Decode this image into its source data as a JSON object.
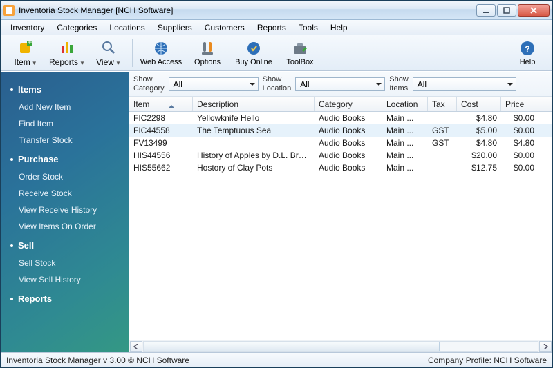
{
  "window": {
    "title": "Inventoria Stock Manager [NCH Software]"
  },
  "menu": [
    "Inventory",
    "Categories",
    "Locations",
    "Suppliers",
    "Customers",
    "Reports",
    "Tools",
    "Help"
  ],
  "toolbar": {
    "item": "Item",
    "reports": "Reports",
    "view": "View",
    "web_access": "Web Access",
    "options": "Options",
    "buy_online": "Buy Online",
    "toolbox": "ToolBox",
    "help": "Help"
  },
  "filters": {
    "show_category_label": "Show\nCategory",
    "show_category_value": "All",
    "show_location_label": "Show\nLocation",
    "show_location_value": "All",
    "show_items_label": "Show\nItems",
    "show_items_value": "All"
  },
  "sidebar": {
    "sections": [
      {
        "header": "Items",
        "items": [
          "Add New Item",
          "Find Item",
          "Transfer Stock"
        ]
      },
      {
        "header": "Purchase",
        "items": [
          "Order Stock",
          "Receive Stock",
          "View Receive History",
          "View Items On Order"
        ]
      },
      {
        "header": "Sell",
        "items": [
          "Sell Stock",
          "View Sell History"
        ]
      },
      {
        "header": "Reports",
        "items": []
      }
    ]
  },
  "grid": {
    "columns": [
      "Item",
      "Description",
      "Category",
      "Location",
      "Tax",
      "Cost",
      "Price"
    ],
    "rows": [
      {
        "item": "FIC2298",
        "desc": "Yellowknife Hello",
        "cat": "Audio Books",
        "loc": "Main ...",
        "tax": "",
        "cost": "$4.80",
        "price": "$0.00"
      },
      {
        "item": "FIC44558",
        "desc": "The Temptuous Sea",
        "cat": "Audio Books",
        "loc": "Main ...",
        "tax": "GST",
        "cost": "$5.00",
        "price": "$0.00"
      },
      {
        "item": "FV13499",
        "desc": "",
        "cat": "Audio Books",
        "loc": "Main ...",
        "tax": "GST",
        "cost": "$4.80",
        "price": "$4.80"
      },
      {
        "item": "HIS44556",
        "desc": "History of Apples by D.L. Brewer",
        "cat": "Audio Books",
        "loc": "Main ...",
        "tax": "",
        "cost": "$20.00",
        "price": "$0.00"
      },
      {
        "item": "HIS55662",
        "desc": "Hostory of Clay Pots",
        "cat": "Audio Books",
        "loc": "Main ...",
        "tax": "",
        "cost": "$12.75",
        "price": "$0.00"
      }
    ]
  },
  "status": {
    "left": "Inventoria Stock Manager v 3.00 © NCH Software",
    "right": "Company Profile: NCH Software"
  }
}
